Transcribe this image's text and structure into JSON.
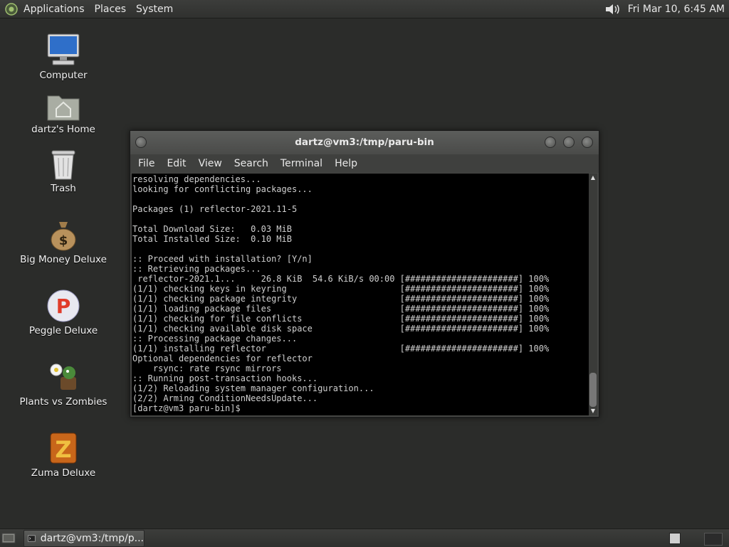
{
  "top_panel": {
    "menus": [
      "Applications",
      "Places",
      "System"
    ],
    "clock": "Fri Mar 10,  6:45 AM"
  },
  "desktop_icons": [
    {
      "label": "Computer"
    },
    {
      "label": "dartz's Home"
    },
    {
      "label": "Trash"
    },
    {
      "label": "Big Money Deluxe"
    },
    {
      "label": "Peggle Deluxe"
    },
    {
      "label": "Plants vs Zombies"
    },
    {
      "label": "Zuma Deluxe"
    }
  ],
  "terminal_window": {
    "title": "dartz@vm3:/tmp/paru-bin",
    "menu": [
      "File",
      "Edit",
      "View",
      "Search",
      "Terminal",
      "Help"
    ],
    "lines": [
      "resolving dependencies...",
      "looking for conflicting packages...",
      "",
      "Packages (1) reflector-2021.11-5",
      "",
      "Total Download Size:   0.03 MiB",
      "Total Installed Size:  0.10 MiB",
      "",
      ":: Proceed with installation? [Y/n]",
      ":: Retrieving packages...",
      " reflector-2021.1...     26.8 KiB  54.6 KiB/s 00:00 [######################] 100%",
      "(1/1) checking keys in keyring                      [######################] 100%",
      "(1/1) checking package integrity                    [######################] 100%",
      "(1/1) loading package files                         [######################] 100%",
      "(1/1) checking for file conflicts                   [######################] 100%",
      "(1/1) checking available disk space                 [######################] 100%",
      ":: Processing package changes...",
      "(1/1) installing reflector                          [######################] 100%",
      "Optional dependencies for reflector",
      "    rsync: rate rsync mirrors",
      ":: Running post-transaction hooks...",
      "(1/2) Reloading system manager configuration...",
      "(2/2) Arming ConditionNeedsUpdate...",
      "[dartz@vm3 paru-bin]$ "
    ]
  },
  "taskbar": {
    "task_label": "dartz@vm3:/tmp/p..."
  },
  "colors": {
    "desktop_bg": "#2b2c2a",
    "terminal_bg": "#000000",
    "terminal_fg": "#cfcfcf"
  }
}
